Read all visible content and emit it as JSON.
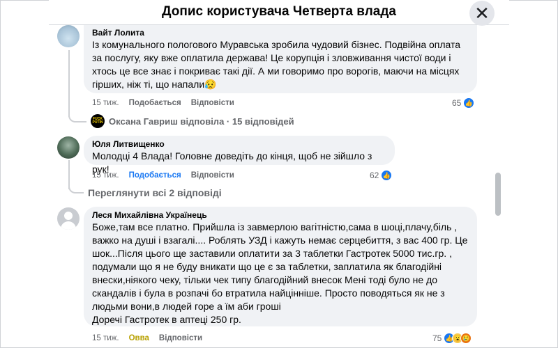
{
  "header": {
    "title": "Допис користувача Четверта влада",
    "close_icon": "close-icon"
  },
  "comments": [
    {
      "author": "Вайт Лолита",
      "text": "Із комунального пологового Муравська зробила чудовий бізнес. Подвійна оплата\nза послугу, яку вже оплатила держава! Це корупція і зловживання чистої води і\nхтось це все знає і покриває такі дії. А ми говоримо про ворогів, маючи на місцях\nгірших, ніж ті, що напали😥",
      "time": "15 тиж.",
      "like_label": "Подобається",
      "reply_label": "Відповісти",
      "reaction_count": "65",
      "reply_summary": "Оксана Гавриш відповіла · 15 відповідей"
    },
    {
      "author": "Юля Литвищенко",
      "text": "Молодці 4 Влада! Головне доведіть до кінця, щоб не зійшло з рук!",
      "time": "15 тиж.",
      "like_label": "Подобається",
      "reply_label": "Відповісти",
      "reaction_count": "62",
      "view_more": "Переглянути всі 2 відповіді"
    },
    {
      "author": "Леся Михайлівна Українець",
      "text": "Боже,там все платно. Прийшла із завмерлою вагітністю,сама в шоці,плачу,біль ,\nважко на душі і взагалі.... Роблять УЗД і кажуть немає серцебиття, з вас 400 гр. Це\nшок...Після цього ще заставили оплатити за 3 таблетки Гастротек 5000 тис.гр. ,\nподумали що я не буду вникати що це є за таблетки, заплатила як благодійні\nвнески,ніякого чеку, тільки чек типу благодійний внесок Мені тоді було не до\nскандалів і була в розпачі бо втратила найцінніше. Просто поводяться як не з\nлюдьми вони,в людей горе а їм аби гроші\nДоречі Гастротек в аптеці 250 гр.",
      "time": "15 тиж.",
      "like_label": "Овва",
      "reply_label": "Відповісти",
      "reaction_count": "75"
    }
  ],
  "avatar_small_text": "FUCK PUTIN",
  "colors": {
    "bubble": "#f0f2f5",
    "accent": "#1877f2",
    "secondary_text": "#65676b"
  }
}
